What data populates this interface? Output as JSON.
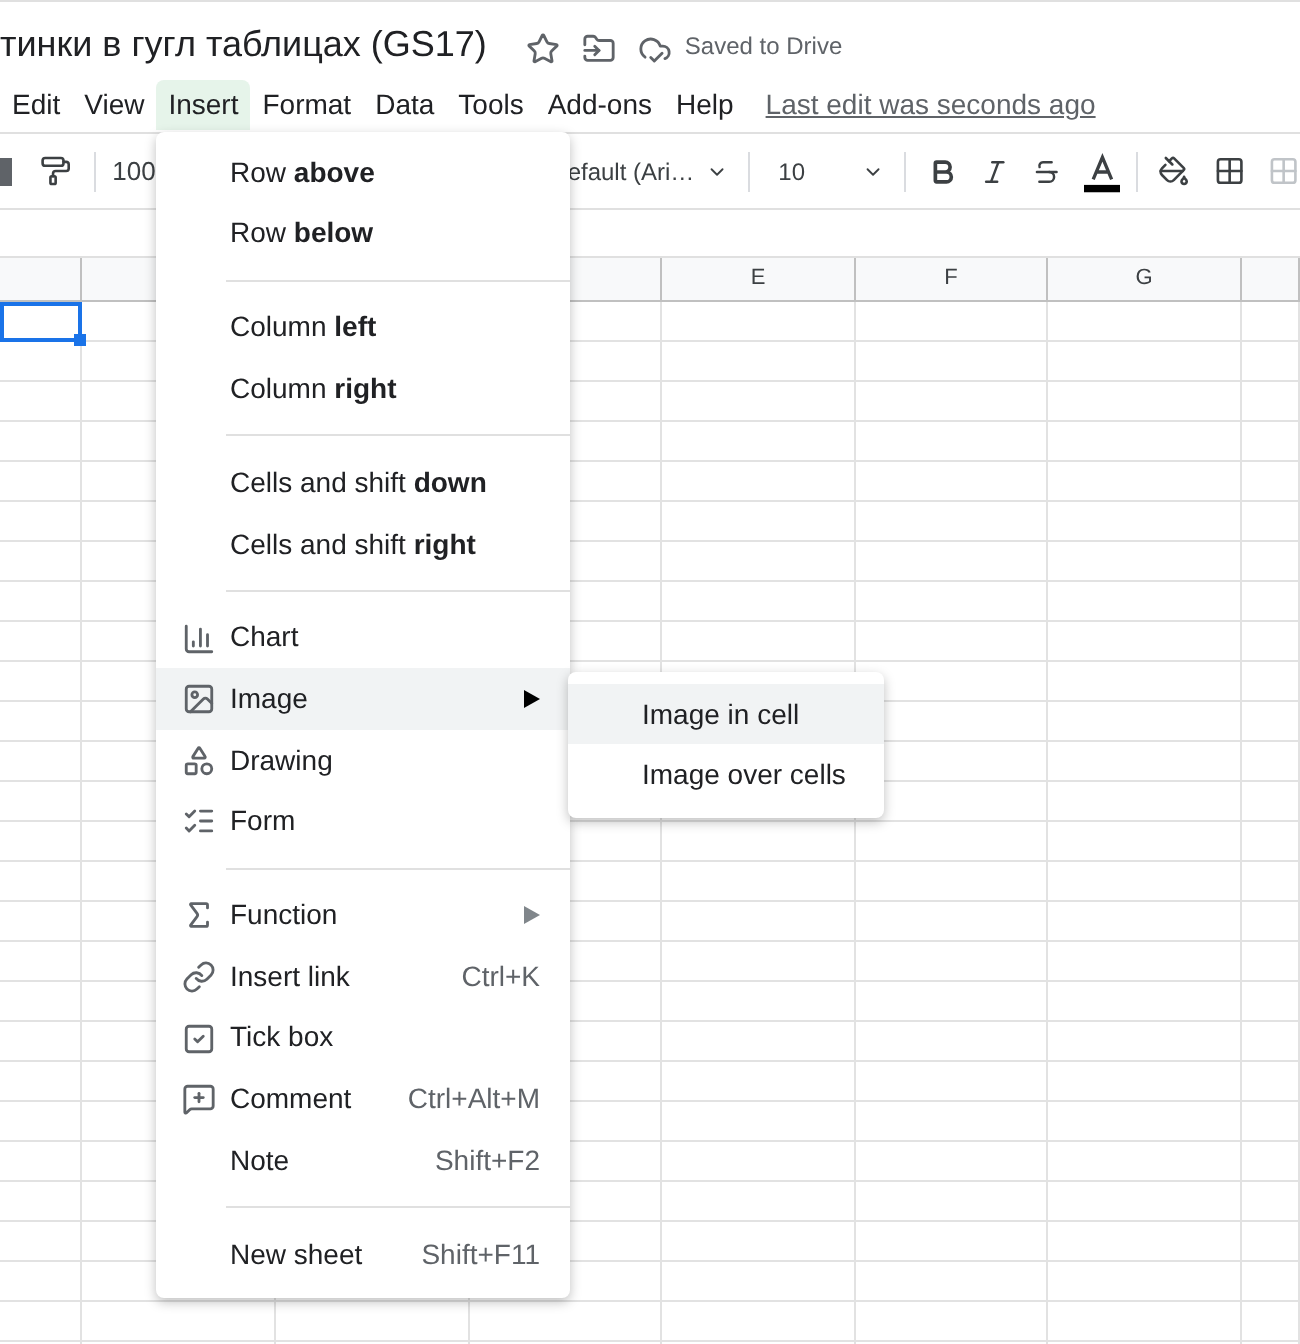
{
  "document": {
    "title": "тинки в гугл таблицах (GS17)",
    "status": "Saved to Drive"
  },
  "menu_bar": {
    "items": [
      {
        "label": "Edit",
        "selected": false
      },
      {
        "label": "View",
        "selected": false
      },
      {
        "label": "Insert",
        "selected": true
      },
      {
        "label": "Format",
        "selected": false
      },
      {
        "label": "Data",
        "selected": false
      },
      {
        "label": "Tools",
        "selected": false
      },
      {
        "label": "Add-ons",
        "selected": false
      },
      {
        "label": "Help",
        "selected": false
      }
    ],
    "last_edit": "Last edit was seconds ago"
  },
  "toolbar": {
    "zoom": "100",
    "font": "efault (Ari…",
    "font_size": "10"
  },
  "columns": [
    {
      "label": "E"
    },
    {
      "label": "F"
    },
    {
      "label": "G"
    }
  ],
  "insert_menu": {
    "items": [
      {
        "kind": "plain",
        "label": "Row **above**",
        "selected": false,
        "submenu": false
      },
      {
        "kind": "plain",
        "label": "Row **below**",
        "selected": false,
        "submenu": false
      },
      {
        "kind": "separator"
      },
      {
        "kind": "plain",
        "label": "Column **left**",
        "selected": false,
        "submenu": false
      },
      {
        "kind": "plain",
        "label": "Column **right**",
        "selected": false,
        "submenu": false
      },
      {
        "kind": "separator"
      },
      {
        "kind": "plain",
        "label": "Cells and shift **down**",
        "selected": false,
        "submenu": false
      },
      {
        "kind": "plain",
        "label": "Cells and shift **right**",
        "selected": false,
        "submenu": false
      },
      {
        "kind": "separator"
      },
      {
        "kind": "chart",
        "label": "Chart",
        "selected": false,
        "submenu": false
      },
      {
        "kind": "image",
        "label": "Image",
        "selected": true,
        "submenu": true
      },
      {
        "kind": "drawing",
        "label": "Drawing",
        "selected": false,
        "submenu": false
      },
      {
        "kind": "form",
        "label": "Form",
        "selected": false,
        "submenu": false
      },
      {
        "kind": "separator"
      },
      {
        "kind": "function",
        "label": "Function",
        "selected": false,
        "submenu": true
      },
      {
        "kind": "link",
        "label": "Insert link",
        "shortcut": "Ctrl+K",
        "selected": false,
        "submenu": false
      },
      {
        "kind": "tickbox",
        "label": "Tick box",
        "selected": false,
        "submenu": false
      },
      {
        "kind": "comment",
        "label": "Comment",
        "shortcut": "Ctrl+Alt+M",
        "selected": false,
        "submenu": false
      },
      {
        "kind": "plain",
        "label": "Note",
        "shortcut": "Shift+F2",
        "selected": false,
        "submenu": false
      },
      {
        "kind": "separator"
      },
      {
        "kind": "plain",
        "label": "New sheet",
        "shortcut": "Shift+F11",
        "selected": false,
        "submenu": false
      }
    ]
  },
  "image_submenu": {
    "items": [
      {
        "label": "Image in cell",
        "selected": true
      },
      {
        "label": "Image over cells",
        "selected": false
      }
    ]
  }
}
